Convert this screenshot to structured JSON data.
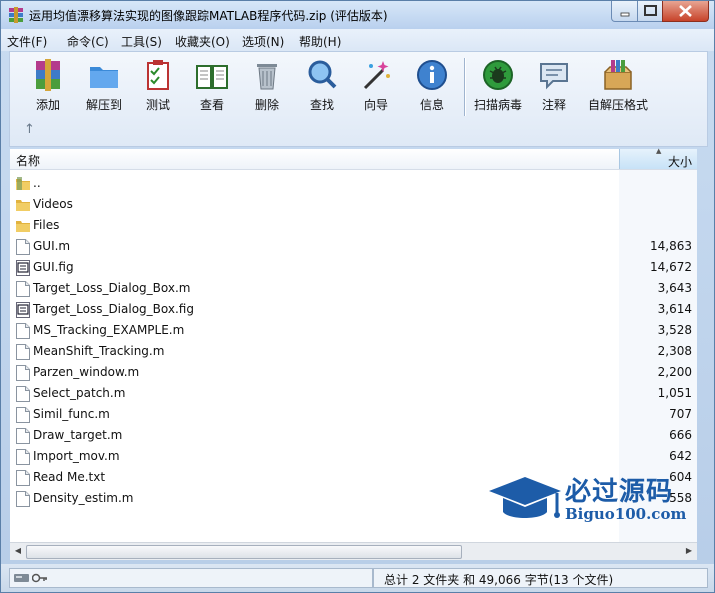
{
  "window": {
    "title": "运用均值漂移算法实现的图像跟踪MATLAB程序代码.zip (评估版本)"
  },
  "menu": [
    "文件(F)",
    "命令(C)",
    "工具(S)",
    "收藏夹(O)",
    "选项(N)",
    "帮助(H)"
  ],
  "toolbar": [
    {
      "label": "添加",
      "icon": "add-archive-icon"
    },
    {
      "label": "解压到",
      "icon": "extract-to-folder-icon"
    },
    {
      "label": "测试",
      "icon": "test-checklist-icon"
    },
    {
      "label": "查看",
      "icon": "view-book-icon"
    },
    {
      "label": "删除",
      "icon": "delete-trash-icon"
    },
    {
      "label": "查找",
      "icon": "find-magnifier-icon"
    },
    {
      "label": "向导",
      "icon": "wizard-wand-icon"
    },
    {
      "label": "信息",
      "icon": "info-icon"
    },
    {
      "label": "扫描病毒",
      "icon": "virus-scan-icon"
    },
    {
      "label": "注释",
      "icon": "comment-icon"
    },
    {
      "label": "自解压格式",
      "icon": "sfx-box-icon"
    }
  ],
  "up_arrow": "↑",
  "columns": {
    "name": "名称",
    "size": "大小"
  },
  "files": [
    {
      "name": "..",
      "size": "",
      "type": "up"
    },
    {
      "name": "Videos",
      "size": "",
      "type": "folder"
    },
    {
      "name": "Files",
      "size": "",
      "type": "folder"
    },
    {
      "name": "GUI.m",
      "size": "14,863",
      "type": "file"
    },
    {
      "name": "GUI.fig",
      "size": "14,672",
      "type": "fig"
    },
    {
      "name": "Target_Loss_Dialog_Box.m",
      "size": "3,643",
      "type": "file"
    },
    {
      "name": "Target_Loss_Dialog_Box.fig",
      "size": "3,614",
      "type": "fig"
    },
    {
      "name": "MS_Tracking_EXAMPLE.m",
      "size": "3,528",
      "type": "file"
    },
    {
      "name": "MeanShift_Tracking.m",
      "size": "2,308",
      "type": "file"
    },
    {
      "name": "Parzen_window.m",
      "size": "2,200",
      "type": "file"
    },
    {
      "name": "Select_patch.m",
      "size": "1,051",
      "type": "file"
    },
    {
      "name": "Simil_func.m",
      "size": "707",
      "type": "file"
    },
    {
      "name": "Draw_target.m",
      "size": "666",
      "type": "file"
    },
    {
      "name": "Import_mov.m",
      "size": "642",
      "type": "file"
    },
    {
      "name": "Read Me.txt",
      "size": "604",
      "type": "file"
    },
    {
      "name": "Density_estim.m",
      "size": "558",
      "type": "file"
    }
  ],
  "status": {
    "summary": "总计 2 文件夹 和 49,066 字节(13 个文件)"
  },
  "watermark": {
    "title": "必过源码",
    "subtitle": "Biguo100.com"
  },
  "colors": {
    "accent": "#1d5ca8",
    "title_bar": "#b9d0ee"
  }
}
